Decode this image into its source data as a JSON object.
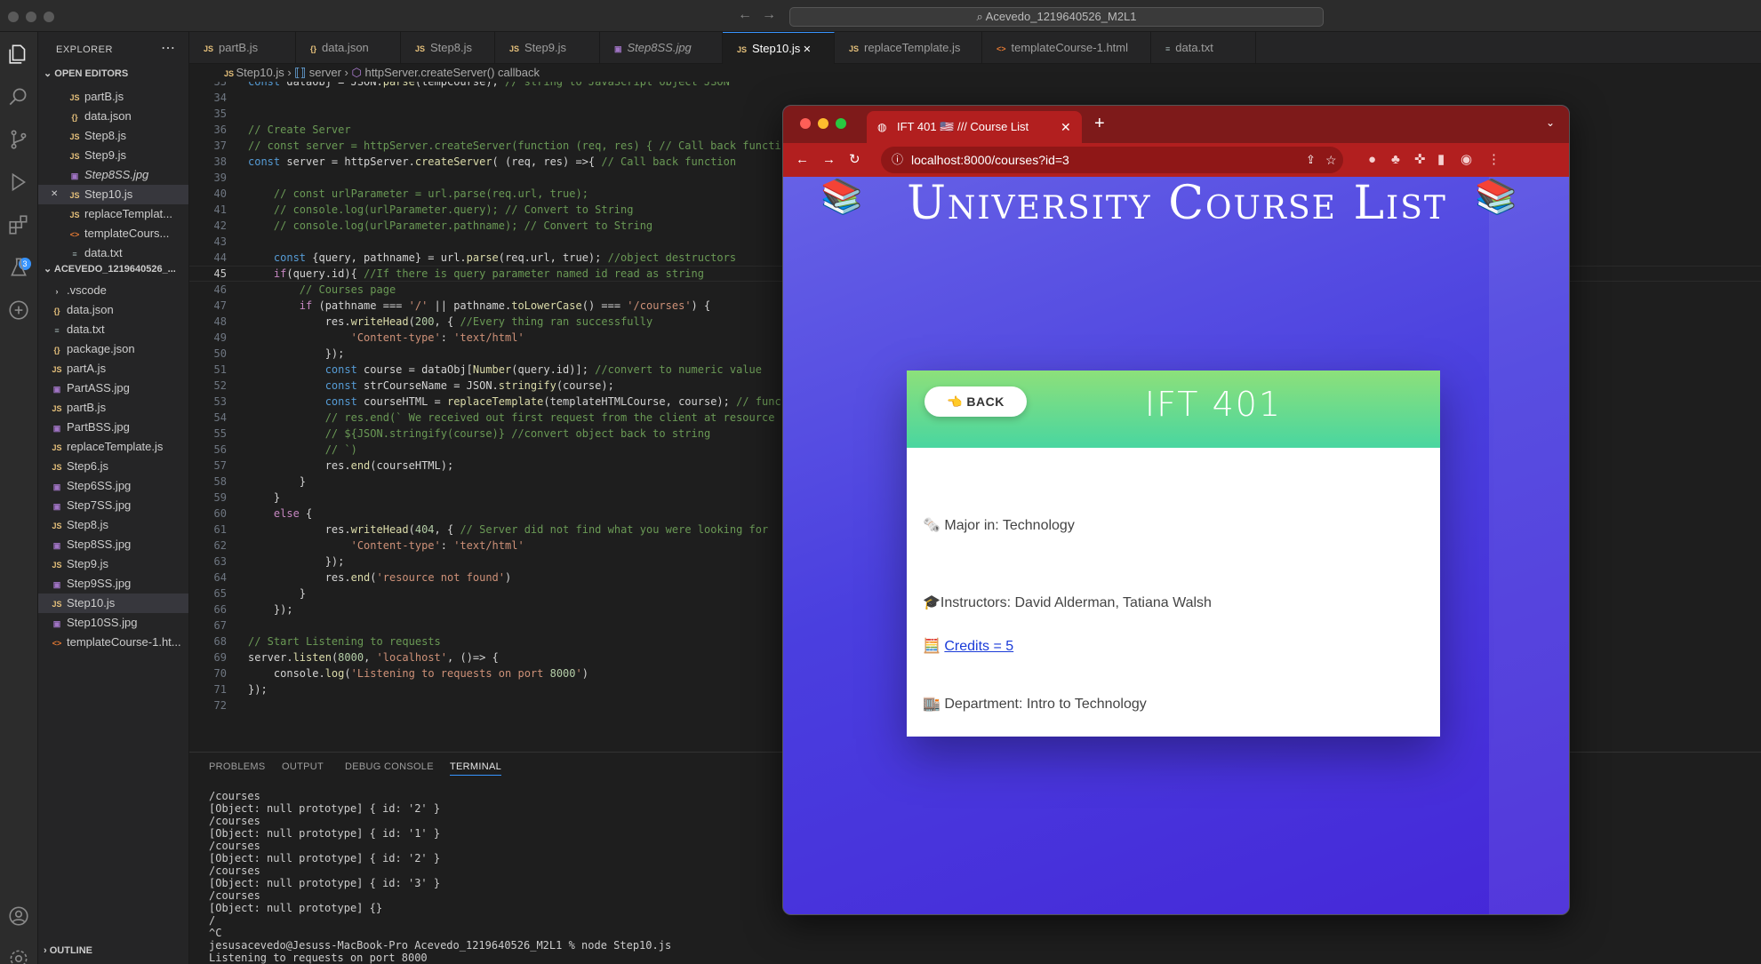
{
  "window": {
    "command_center": "Acevedo_1219640526_M2L1"
  },
  "sidebar": {
    "title": "EXPLORER",
    "open_editors_label": "OPEN EDITORS",
    "open_editors": [
      {
        "label": "partB.js",
        "type": "js"
      },
      {
        "label": "data.json",
        "type": "json"
      },
      {
        "label": "Step8.js",
        "type": "js"
      },
      {
        "label": "Step9.js",
        "type": "js"
      },
      {
        "label": "Step8SS.jpg",
        "type": "img"
      },
      {
        "label": "Step10.js",
        "type": "js"
      },
      {
        "label": "replaceTemplat...",
        "type": "js"
      },
      {
        "label": "templateCours...",
        "type": "html"
      },
      {
        "label": "data.txt",
        "type": "txt"
      }
    ],
    "folder_label": "ACEVEDO_1219640526_...",
    "files": [
      {
        "label": ".vscode",
        "type": "folder"
      },
      {
        "label": "data.json",
        "type": "json"
      },
      {
        "label": "data.txt",
        "type": "txt"
      },
      {
        "label": "package.json",
        "type": "json"
      },
      {
        "label": "partA.js",
        "type": "js"
      },
      {
        "label": "PartASS.jpg",
        "type": "img"
      },
      {
        "label": "partB.js",
        "type": "js"
      },
      {
        "label": "PartBSS.jpg",
        "type": "img"
      },
      {
        "label": "replaceTemplate.js",
        "type": "js"
      },
      {
        "label": "Step6.js",
        "type": "js"
      },
      {
        "label": "Step6SS.jpg",
        "type": "img"
      },
      {
        "label": "Step7SS.jpg",
        "type": "img"
      },
      {
        "label": "Step8.js",
        "type": "js"
      },
      {
        "label": "Step8SS.jpg",
        "type": "img"
      },
      {
        "label": "Step9.js",
        "type": "js"
      },
      {
        "label": "Step9SS.jpg",
        "type": "img"
      },
      {
        "label": "Step10.js",
        "type": "js"
      },
      {
        "label": "Step10SS.jpg",
        "type": "img"
      },
      {
        "label": "templateCourse-1.ht...",
        "type": "html"
      }
    ],
    "outline_label": "OUTLINE",
    "scm_badge": "3"
  },
  "tabs": [
    {
      "label": "partB.js",
      "type": "js"
    },
    {
      "label": "data.json",
      "type": "json"
    },
    {
      "label": "Step8.js",
      "type": "js"
    },
    {
      "label": "Step9.js",
      "type": "js"
    },
    {
      "label": "Step8SS.jpg",
      "type": "img"
    },
    {
      "label": "Step10.js",
      "type": "js",
      "active": true
    },
    {
      "label": "replaceTemplate.js",
      "type": "js"
    },
    {
      "label": "templateCourse-1.html",
      "type": "html"
    },
    {
      "label": "data.txt",
      "type": "txt"
    }
  ],
  "breadcrumb": [
    "Step10.js",
    "server",
    "httpServer.createServer() callback"
  ],
  "editor": {
    "current_line": 45,
    "lines": [
      {
        "n": 33,
        "t": "const dataObj = JSON.parse(tempCourse); // string to JavaScript object JSON"
      },
      {
        "n": 34,
        "t": ""
      },
      {
        "n": 35,
        "t": ""
      },
      {
        "n": 36,
        "t": "// Create Server"
      },
      {
        "n": 37,
        "t": "// const server = httpServer.createServer(function (req, res) { // Call back functi"
      },
      {
        "n": 38,
        "t": "const server = httpServer.createServer( (req, res) =>{ // Call back function"
      },
      {
        "n": 39,
        "t": ""
      },
      {
        "n": 40,
        "t": "    // const urlParameter = url.parse(req.url, true);"
      },
      {
        "n": 41,
        "t": "    // console.log(urlParameter.query); // Convert to String"
      },
      {
        "n": 42,
        "t": "    // console.log(urlParameter.pathname); // Convert to String"
      },
      {
        "n": 43,
        "t": ""
      },
      {
        "n": 44,
        "t": "    const {query, pathname} = url.parse(req.url, true); //object destructors"
      },
      {
        "n": 45,
        "t": "    if(query.id){ //If there is query parameter named id read as string"
      },
      {
        "n": 46,
        "t": "        // Courses page"
      },
      {
        "n": 47,
        "t": "        if (pathname === '/' || pathname.toLowerCase() === '/courses') {"
      },
      {
        "n": 48,
        "t": "            res.writeHead(200, { //Every thing ran successfully"
      },
      {
        "n": 49,
        "t": "                'Content-type': 'text/html'"
      },
      {
        "n": 50,
        "t": "            });"
      },
      {
        "n": 51,
        "t": "            const course = dataObj[Number(query.id)]; //convert to numeric value"
      },
      {
        "n": 52,
        "t": "            const strCourseName = JSON.stringify(course);"
      },
      {
        "n": 53,
        "t": "            const courseHTML = replaceTemplate(templateHTMLCourse, course); // func"
      },
      {
        "n": 54,
        "t": "            // res.end(` We received out first request from the client at resource"
      },
      {
        "n": 55,
        "t": "            // ${JSON.stringify(course)} //convert object back to string"
      },
      {
        "n": 56,
        "t": "            // `)"
      },
      {
        "n": 57,
        "t": "            res.end(courseHTML);"
      },
      {
        "n": 58,
        "t": "        }"
      },
      {
        "n": 59,
        "t": "    }"
      },
      {
        "n": 60,
        "t": "    else {"
      },
      {
        "n": 61,
        "t": "            res.writeHead(404, { // Server did not find what you were looking for"
      },
      {
        "n": 62,
        "t": "                'Content-type': 'text/html'"
      },
      {
        "n": 63,
        "t": "            });"
      },
      {
        "n": 64,
        "t": "            res.end('resource not found')"
      },
      {
        "n": 65,
        "t": "        }"
      },
      {
        "n": 66,
        "t": "    });"
      },
      {
        "n": 67,
        "t": ""
      },
      {
        "n": 68,
        "t": "// Start Listening to requests"
      },
      {
        "n": 69,
        "t": "server.listen(8000, 'localhost', ()=> {"
      },
      {
        "n": 70,
        "t": "    console.log('Listening to requests on port 8000')"
      },
      {
        "n": 71,
        "t": "});"
      },
      {
        "n": 72,
        "t": ""
      }
    ]
  },
  "panel": {
    "tabs": [
      "PROBLEMS",
      "OUTPUT",
      "DEBUG CONSOLE",
      "TERMINAL"
    ],
    "active_tab": "TERMINAL",
    "terminal_lines": [
      "/courses",
      "[Object: null prototype] { id: '2' }",
      "/courses",
      "[Object: null prototype] { id: '1' }",
      "/courses",
      "[Object: null prototype] { id: '2' }",
      "/courses",
      "[Object: null prototype] { id: '3' }",
      "/courses",
      "[Object: null prototype] {}",
      "/",
      "^C",
      "jesusacevedo@Jesuss-MacBook-Pro Acevedo_1219640526_M2L1 % node Step10.js",
      "Listening to requests on port 8000"
    ]
  },
  "browser": {
    "tab_title": "IFT 401 🇺🇸 /// Course List",
    "url": "localhost:8000/courses?id=3",
    "page": {
      "title": "University Course List",
      "book_emoji": "📚",
      "back_label": "👈 BACK",
      "course_name": "IFT 401",
      "major": "🗞️  Major in: Technology",
      "instructors": "🎓Instructors: David Alderman, Tatiana Walsh",
      "credits_prefix": "🧮 ",
      "credits_link": "Credits = 5",
      "department": "🏬 Department: Intro to Technology"
    }
  },
  "colors": {
    "accent": "#3794ff",
    "browser_frame": "#b21f1f",
    "page_bg": "#4a3fdc",
    "card_header": "#49d6a0"
  }
}
